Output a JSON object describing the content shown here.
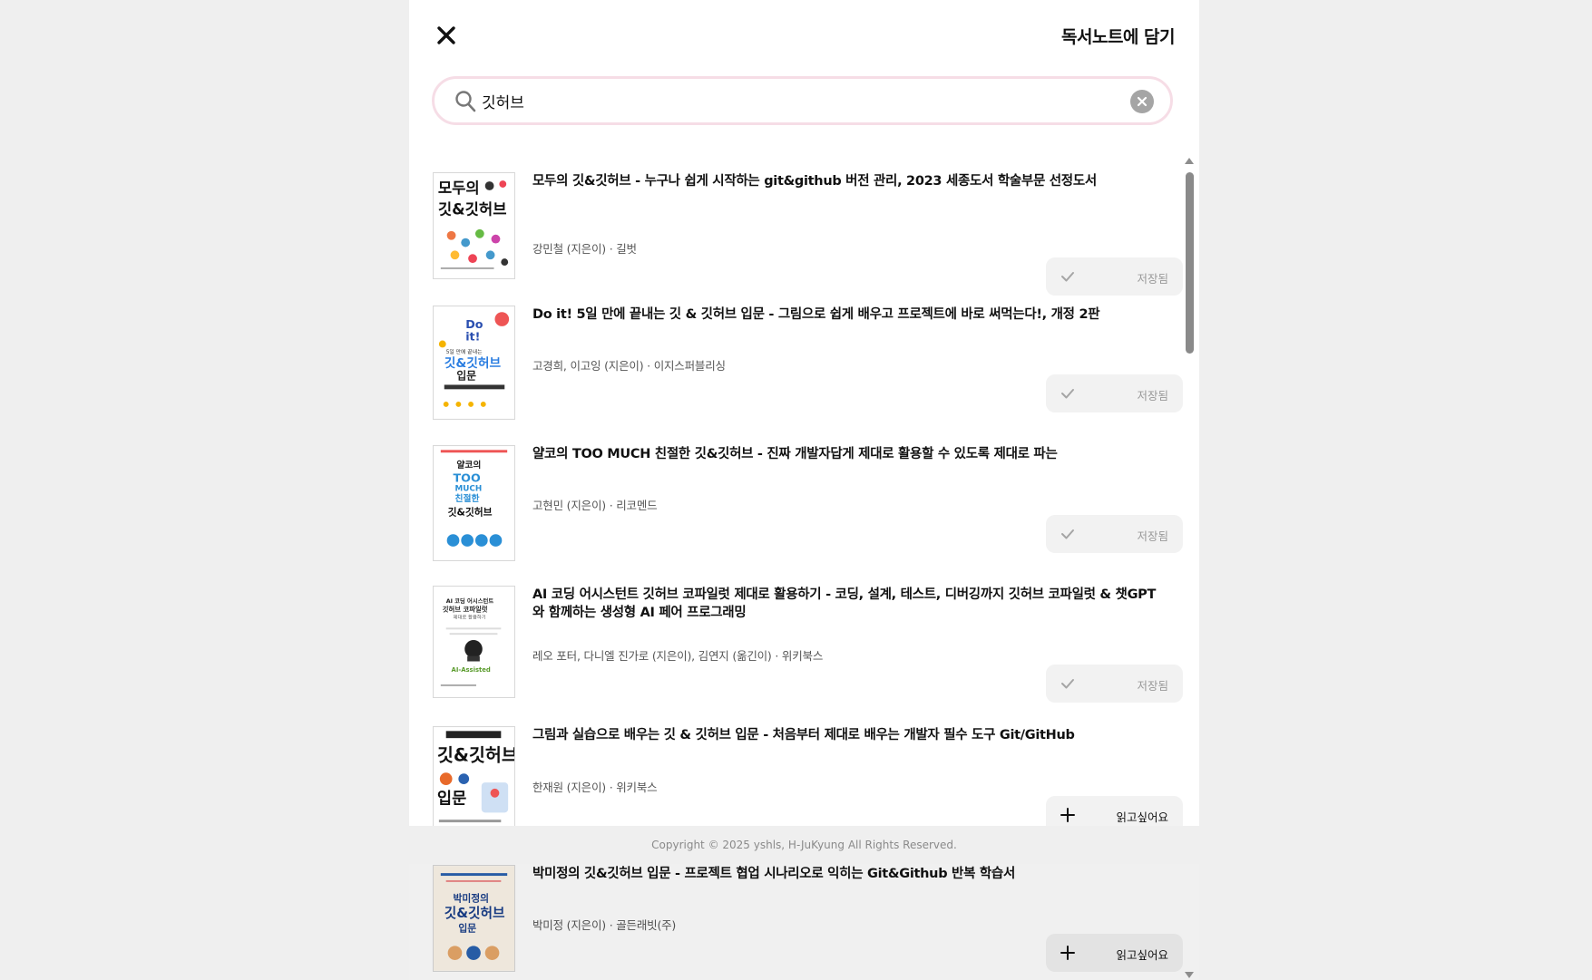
{
  "header": {
    "title": "독서노트에 담기"
  },
  "search": {
    "value": "깃허브",
    "placeholder": ""
  },
  "results": [
    {
      "title": "모두의 깃&깃허브 - 누구나 쉽게 시작하는 git&github 버전 관리, 2023 세종도서 학술부문 선정도서",
      "meta": "강민철 (지은이) · 길벗",
      "action_label": "저장됨",
      "status": "saved",
      "cover_title": "모두의 깃&깃허브"
    },
    {
      "title": "Do it! 5일 만에 끝내는 깃 & 깃허브 입문 - 그림으로 쉽게 배우고 프로젝트에 바로 써먹는다!, 개정 2판",
      "meta": "고경희, 이고잉 (지은이) · 이지스퍼블리싱",
      "action_label": "저장됨",
      "status": "saved",
      "cover_title": "Do it! 깃&깃허브 입문"
    },
    {
      "title": "얄코의 TOO MUCH 친절한 깃&깃허브 - 진짜 개발자답게 제대로 활용할 수 있도록 제대로 파는",
      "meta": "고현민 (지은이) · 리코멘드",
      "action_label": "저장됨",
      "status": "saved",
      "cover_title": "얄코의 TOO MUCH 친절한 깃&깃허브"
    },
    {
      "title": "AI 코딩 어시스턴트 깃허브 코파일럿 제대로 활용하기 - 코딩, 설계, 테스트, 디버깅까지 깃허브 코파일럿 & 챗GPT와 함께하는 생성형 AI 페어 프로그래밍",
      "meta": "레오 포터, 다니엘 진가로 (지은이), 김연지 (옮긴이) · 위키북스",
      "action_label": "저장됨",
      "status": "saved",
      "cover_title": "AI 코딩 어시스턴트 깃허브 코파일럿"
    },
    {
      "title": "그림과 실습으로 배우는 깃 & 깃허브 입문 - 처음부터 제대로 배우는 개발자 필수 도구 Git/GitHub",
      "meta": "한재원 (지은이) · 위키북스",
      "action_label": "읽고싶어요",
      "status": "want",
      "cover_title": "깃&깃허브 입문"
    },
    {
      "title": "박미정의 깃&깃허브 입문 - 프로젝트 협업 시나리오로 익히는 Git&Github 반복 학습서",
      "meta": "박미정 (지은이) · 골든래빗(주)",
      "action_label": "읽고싶어요",
      "status": "want",
      "cover_title": "박미정의 깃&깃허브 입문"
    }
  ],
  "footer": {
    "copyright": "Copyright © 2025 yshls, H-JuKyung All Rights Reserved."
  },
  "colors": {
    "search_border": "#f6dde6",
    "button_bg": "#f2f2f2",
    "muted_text": "#9a9a9a",
    "page_bg": "#efefef"
  },
  "icons": {
    "close": "close-icon",
    "search": "search-icon",
    "clear": "clear-icon",
    "saved": "check-icon",
    "want": "plus-icon"
  }
}
